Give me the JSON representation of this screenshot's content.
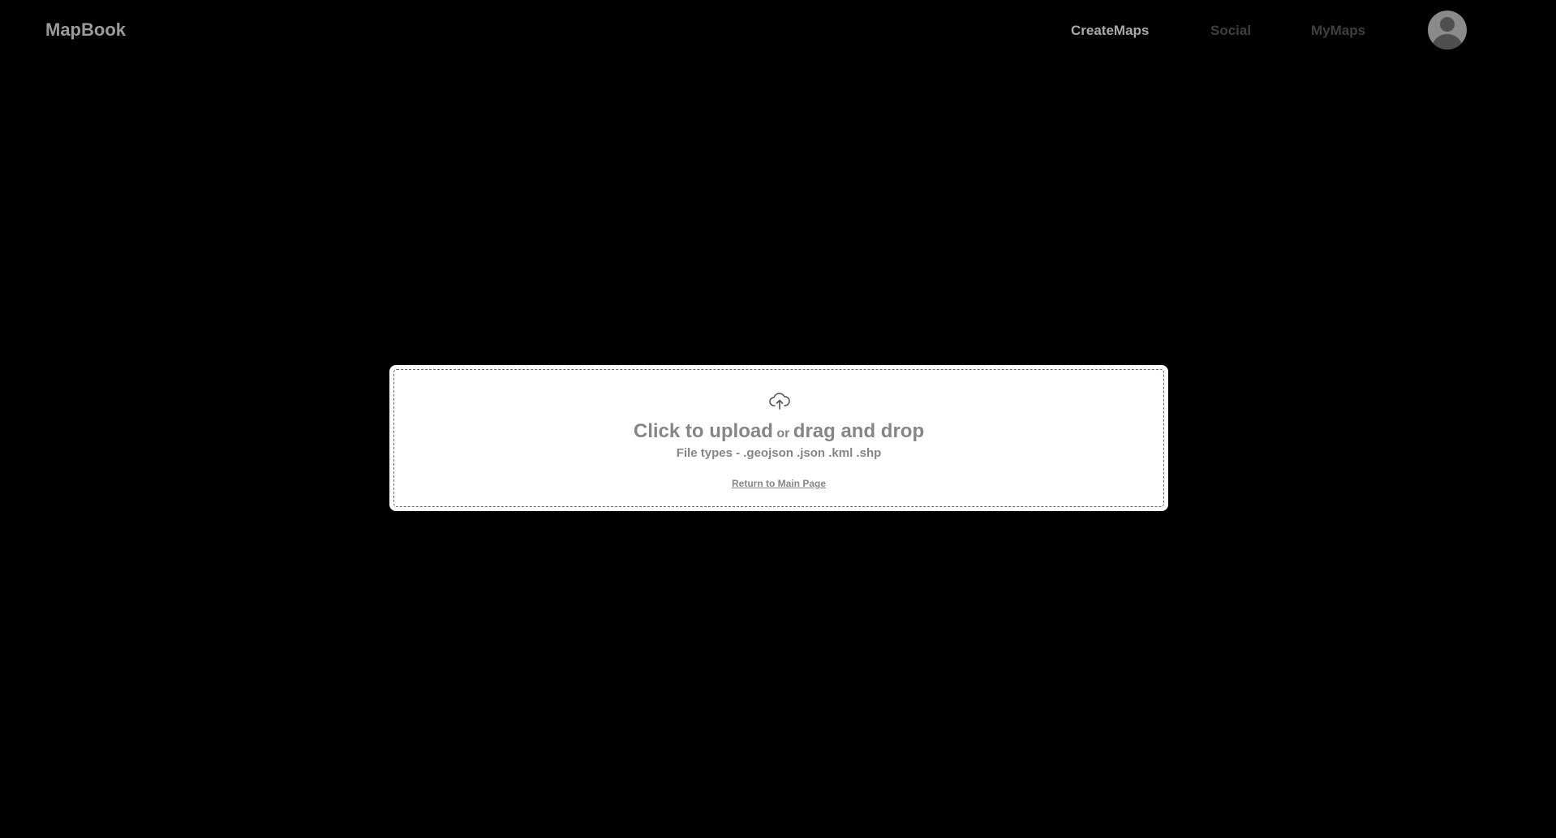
{
  "app": {
    "brand": "MapBook"
  },
  "nav": {
    "items": [
      {
        "label": "CreateMaps",
        "state": "active"
      },
      {
        "label": "Social",
        "state": "inactive"
      },
      {
        "label": "MyMaps",
        "state": "inactive"
      }
    ],
    "avatar_icon": "user-avatar-icon"
  },
  "upload": {
    "icon": "cloud-upload-icon",
    "click_text": "Click to upload",
    "or_text": "or",
    "drag_text": "drag and drop",
    "file_types": "File types - .geojson .json .kml .shp",
    "return_link": "Return to Main Page"
  },
  "colors": {
    "background": "#000000",
    "card": "#ffffff",
    "text_muted": "#868686",
    "nav_active": "#a9a9a9",
    "nav_inactive": "#3f3f3f"
  }
}
